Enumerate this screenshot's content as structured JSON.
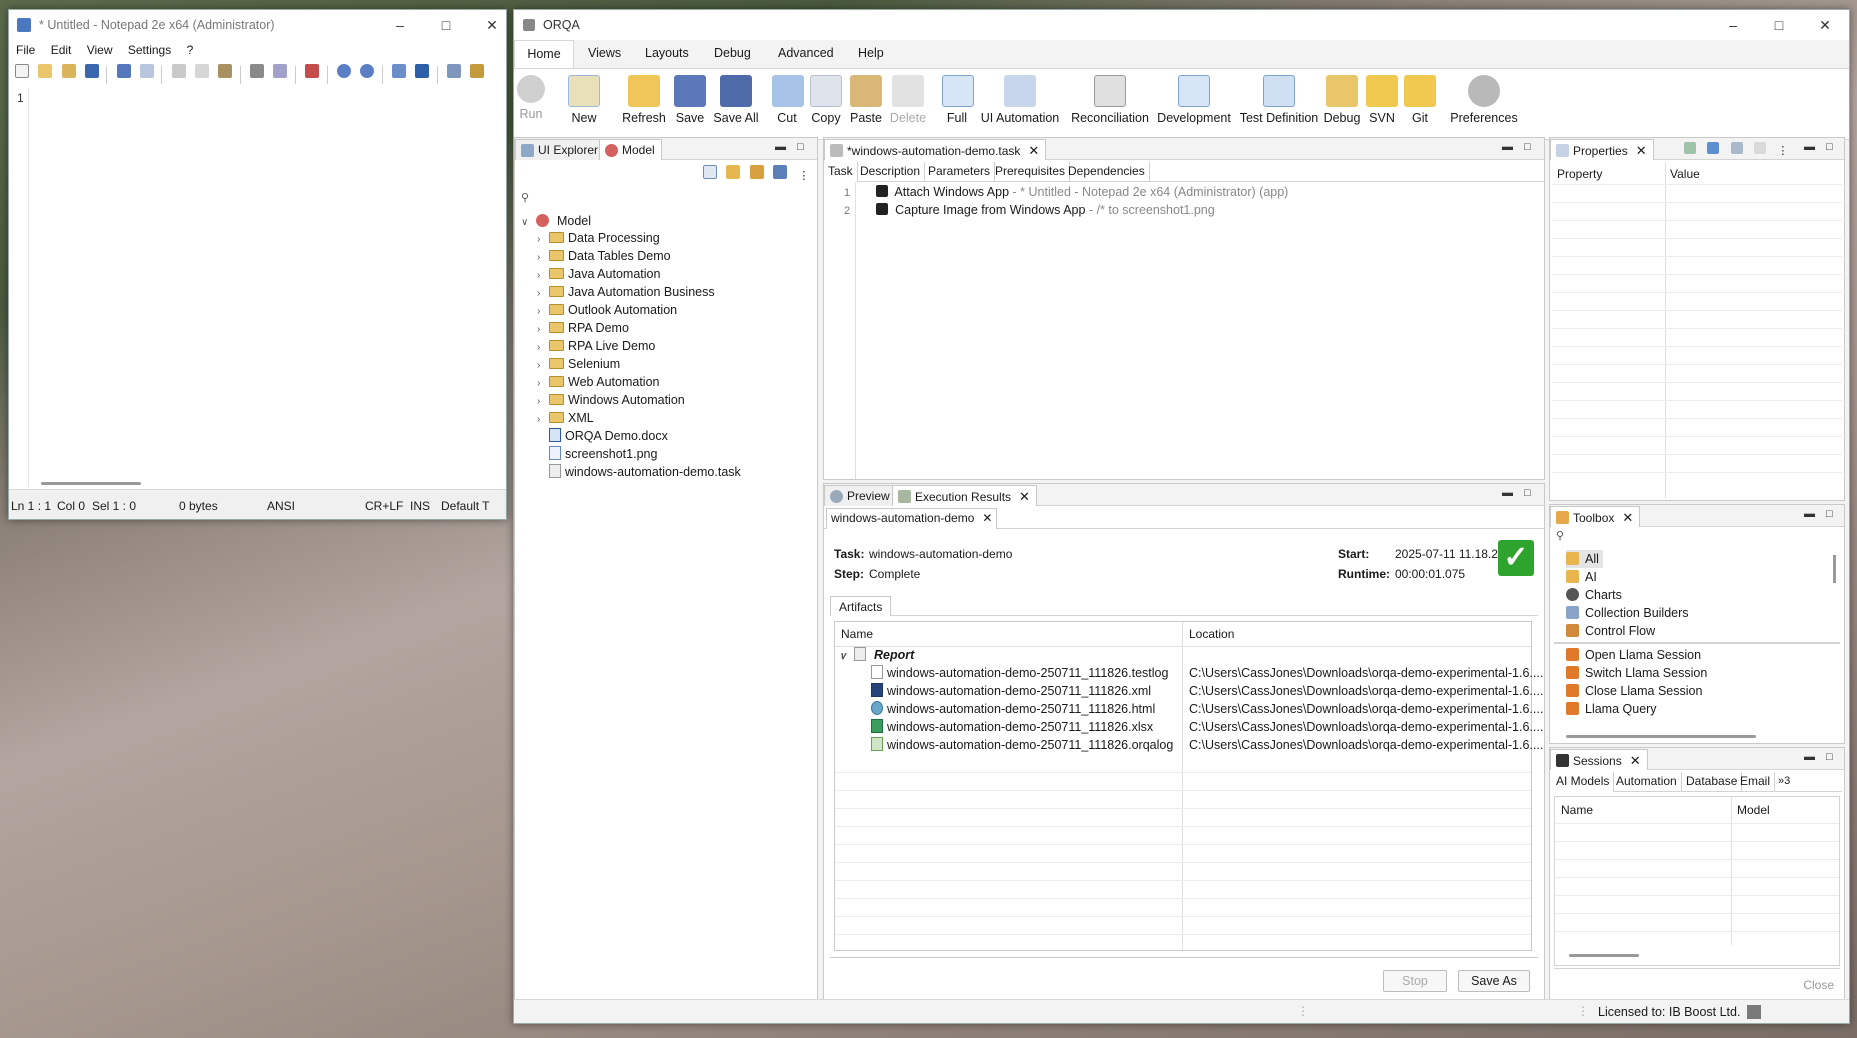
{
  "notepad": {
    "title": "* Untitled - Notepad 2e x64 (Administrator)",
    "menu": [
      "File",
      "Edit",
      "View",
      "Settings",
      "?"
    ],
    "line_number": "1",
    "status": {
      "pos": "Ln 1 : 1",
      "col": "Col 0",
      "sel": "Sel 1 : 0",
      "bytes": "0 bytes",
      "encoding": "ANSI",
      "eol": "CR+LF",
      "mode": "INS",
      "scheme": "Default T"
    }
  },
  "orqa": {
    "title": "ORQA",
    "menu": [
      "Home",
      "Views",
      "Layouts",
      "Debug",
      "Advanced",
      "Help"
    ],
    "toolbar": [
      "Run",
      "New",
      "Refresh",
      "Save",
      "Save All",
      "Cut",
      "Copy",
      "Paste",
      "Delete",
      "Full",
      "UI Automation",
      "Reconciliation",
      "Development",
      "Test Definition",
      "Debug",
      "SVN",
      "Git",
      "Preferences"
    ],
    "left_tabs": [
      "UI Explorer",
      "Model"
    ],
    "tree": {
      "root": "Model",
      "folders": [
        "Data Processing",
        "Data Tables Demo",
        "Java Automation",
        "Java Automation Business",
        "Outlook Automation",
        "RPA Demo",
        "RPA Live Demo",
        "Selenium",
        "Web Automation",
        "Windows Automation",
        "XML"
      ],
      "files": [
        "ORQA Demo.docx",
        "screenshot1.png",
        "windows-automation-demo.task"
      ]
    },
    "editor": {
      "tab": "*windows-automation-demo.task",
      "subtabs": [
        "Task",
        "Description",
        "Parameters",
        "Prerequisites",
        "Dependencies"
      ],
      "lines": [
        {
          "num": "1",
          "cmd": "Attach Windows App",
          "arg": " - * Untitled - Notepad 2e x64 (Administrator) (app)"
        },
        {
          "num": "2",
          "cmd": "Capture Image from Windows App",
          "arg": " - /* to screenshot1.png"
        }
      ]
    },
    "results": {
      "tabs": [
        "Preview",
        "Execution Results"
      ],
      "subtab": "windows-automation-demo",
      "task_label": "Task:",
      "task_value": "windows-automation-demo",
      "step_label": "Step:",
      "step_value": "Complete",
      "start_label": "Start:",
      "start_value": "2025-07-11 11.18.26",
      "runtime_label": "Runtime:",
      "runtime_value": "00:00:01.075",
      "artifacts_tab": "Artifacts",
      "col_name": "Name",
      "col_location": "Location",
      "group": "Report",
      "rows": [
        {
          "name": "windows-automation-demo-250711_111826.testlog",
          "location": "C:\\Users\\CassJones\\Downloads\\orqa-demo-experimental-1.6...."
        },
        {
          "name": "windows-automation-demo-250711_111826.xml",
          "location": "C:\\Users\\CassJones\\Downloads\\orqa-demo-experimental-1.6...."
        },
        {
          "name": "windows-automation-demo-250711_111826.html",
          "location": "C:\\Users\\CassJones\\Downloads\\orqa-demo-experimental-1.6...."
        },
        {
          "name": "windows-automation-demo-250711_111826.xlsx",
          "location": "C:\\Users\\CassJones\\Downloads\\orqa-demo-experimental-1.6...."
        },
        {
          "name": "windows-automation-demo-250711_111826.orqalog",
          "location": "C:\\Users\\CassJones\\Downloads\\orqa-demo-experimental-1.6...."
        }
      ],
      "stop": "Stop",
      "save_as": "Save As"
    },
    "properties": {
      "tab": "Properties",
      "col_property": "Property",
      "col_value": "Value"
    },
    "toolbox": {
      "tab": "Toolbox",
      "items": [
        "All",
        "AI",
        "Charts",
        "Collection Builders",
        "Control Flow"
      ],
      "llama": [
        "Open Llama Session",
        "Switch Llama Session",
        "Close Llama Session",
        "Llama Query"
      ]
    },
    "sessions": {
      "tab": "Sessions",
      "subtabs": [
        "AI Models",
        "Automation",
        "Database",
        "Email"
      ],
      "overflow": "»3",
      "col_name": "Name",
      "col_model": "Model",
      "close": "Close"
    },
    "status": "Licensed to: IB Boost Ltd."
  },
  "colors": {
    "accent": "#1f6fd0",
    "success": "#2ea42e",
    "folder": "#e9c66a"
  }
}
